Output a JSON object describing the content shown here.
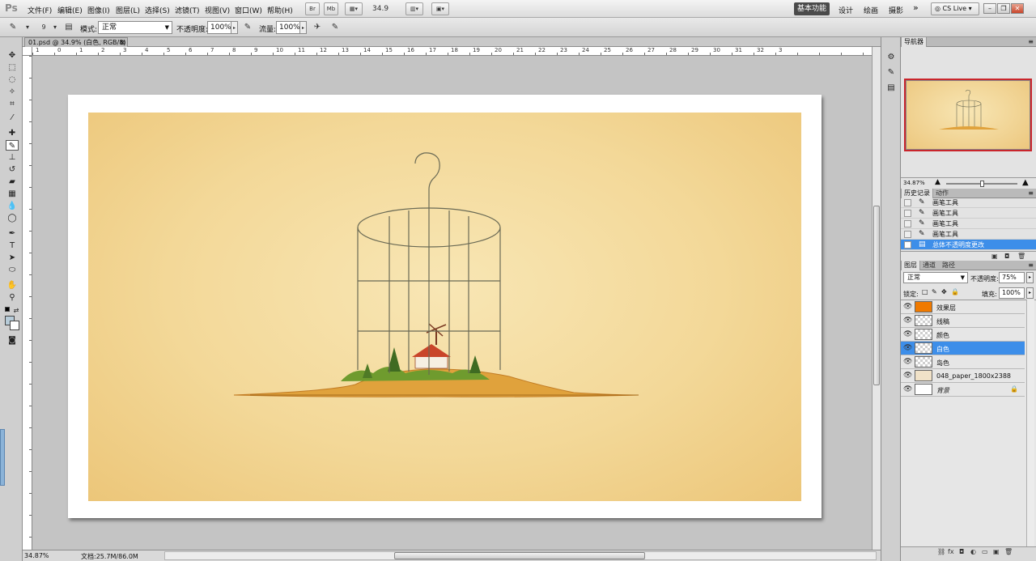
{
  "app": {
    "logo": "Ps"
  },
  "menu": [
    "文件(F)",
    "编辑(E)",
    "图像(I)",
    "图层(L)",
    "选择(S)",
    "滤镜(T)",
    "视图(V)",
    "窗口(W)",
    "帮助(H)"
  ],
  "menubar": {
    "bridge": "Br",
    "minibridge": "Mb",
    "zoom": "34.9",
    "workspaces": {
      "active": "基本功能",
      "items": [
        "设计",
        "绘画",
        "摄影"
      ],
      "more": "»"
    },
    "cs_live": "CS Live"
  },
  "options": {
    "brush_size": "9",
    "mode_label": "模式:",
    "mode_value": "正常",
    "opacity_label": "不透明度:",
    "opacity_value": "100%",
    "flow_label": "流量:",
    "flow_value": "100%"
  },
  "document": {
    "tab_title": "01.psd @ 34.9% (白色, RGB/8)",
    "tab_close": "⊠",
    "ruler_labels": [
      "1",
      "0",
      "1",
      "2",
      "3",
      "4",
      "5",
      "6",
      "7",
      "8",
      "9",
      "10",
      "11",
      "12",
      "13",
      "14",
      "15",
      "16",
      "17",
      "18",
      "19",
      "20",
      "21",
      "22",
      "23",
      "24",
      "25",
      "26",
      "27",
      "28",
      "29",
      "30",
      "31",
      "32",
      "3"
    ]
  },
  "status": {
    "zoom": "34.87%",
    "doc_info": "文档:25.7M/86.0M"
  },
  "navigator": {
    "tab": "导航器",
    "zoom": "34.87%"
  },
  "history": {
    "tabs": [
      "历史记录",
      "动作"
    ],
    "items": [
      {
        "label": "画笔工具",
        "selected": false
      },
      {
        "label": "画笔工具",
        "selected": false
      },
      {
        "label": "画笔工具",
        "selected": false
      },
      {
        "label": "画笔工具",
        "selected": false
      },
      {
        "label": "总体不透明度更改",
        "selected": true
      }
    ]
  },
  "layers": {
    "tabs": [
      "图层",
      "通道",
      "路径"
    ],
    "blend_mode": "正常",
    "opacity_label": "不透明度:",
    "opacity_value": "75%",
    "lock_label": "锁定:",
    "fill_label": "填充:",
    "fill_value": "100%",
    "items": [
      {
        "name": "效果层",
        "selected": false,
        "thumb": "#f07a00"
      },
      {
        "name": "线稿",
        "selected": false,
        "thumb": "checker"
      },
      {
        "name": "颜色",
        "selected": false,
        "thumb": "checker"
      },
      {
        "name": "白色",
        "selected": true,
        "thumb": "checker"
      },
      {
        "name": "岛色",
        "selected": false,
        "thumb": "checker"
      },
      {
        "name": "048_paper_1800x2388",
        "selected": false,
        "thumb": "#f1e2c8"
      },
      {
        "name": "背景",
        "selected": false,
        "thumb": "#ffffff",
        "locked": true
      }
    ]
  },
  "colors": {
    "accent_selected": "#3d8ee9",
    "nav_frame": "#c9252c",
    "paper": "#f3d898"
  }
}
